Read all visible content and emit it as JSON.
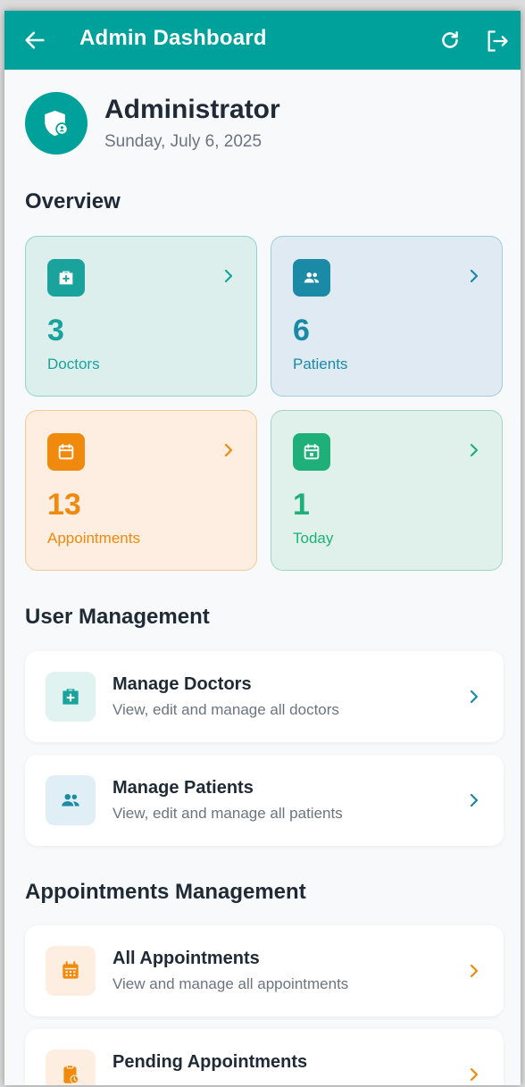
{
  "appbar": {
    "title": "Admin Dashboard"
  },
  "profile": {
    "name": "Administrator",
    "date": "Sunday, July 6, 2025"
  },
  "overview": {
    "title": "Overview",
    "cards": [
      {
        "value": "3",
        "label": "Doctors",
        "icon": "medical-bag-icon",
        "color": "#1aa39c",
        "bg": "#dcefed",
        "border": "#8fd3cf"
      },
      {
        "value": "6",
        "label": "Patients",
        "icon": "people-icon",
        "color": "#1a8aa6",
        "bg": "#dfeaf2",
        "border": "#9ccbe0"
      },
      {
        "value": "13",
        "label": "Appointments",
        "icon": "calendar-icon",
        "color": "#f08a0d",
        "bg": "#fdeee1",
        "border": "#f8c996"
      },
      {
        "value": "1",
        "label": "Today",
        "icon": "calendar-today-icon",
        "color": "#1fb07a",
        "bg": "#dff1ea",
        "border": "#9fd8bf"
      }
    ]
  },
  "user_management": {
    "title": "User Management",
    "items": [
      {
        "title": "Manage Doctors",
        "subtitle": "View, edit and manage all doctors",
        "icon": "medical-bag-icon"
      },
      {
        "title": "Manage Patients",
        "subtitle": "View, edit and manage all patients",
        "icon": "people-icon"
      }
    ]
  },
  "appointments_management": {
    "title": "Appointments Management",
    "items": [
      {
        "title": "All Appointments",
        "subtitle": "View and manage all appointments",
        "icon": "calendar-icon"
      },
      {
        "title": "Pending Appointments",
        "subtitle": "",
        "icon": "clipboard-clock-icon"
      }
    ]
  },
  "colors": {
    "brand": "#00a19a",
    "orange": "#f08a0d",
    "teal_chevron": "#1a8aa6"
  }
}
